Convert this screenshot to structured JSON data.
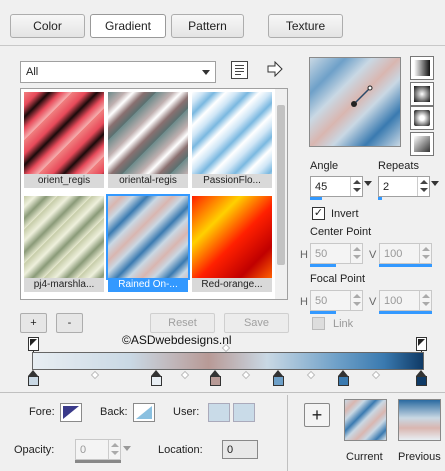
{
  "tabs": {
    "color": "Color",
    "gradient": "Gradient",
    "pattern": "Pattern",
    "texture": "Texture"
  },
  "filter": {
    "selected": "All"
  },
  "gradients": [
    {
      "label": "orient_regis"
    },
    {
      "label": "oriental-regis"
    },
    {
      "label": "PassionFlo..."
    },
    {
      "label": "pj4-marshla..."
    },
    {
      "label": "Rained On-..."
    },
    {
      "label": "Red-orange..."
    }
  ],
  "buttons": {
    "add": "+",
    "remove": "-",
    "reset": "Reset",
    "save": "Save",
    "new_swatch": "+"
  },
  "watermark": "©ASDwebdesigns.nl",
  "angle": {
    "label": "Angle",
    "value": "45"
  },
  "repeats": {
    "label": "Repeats",
    "value": "2"
  },
  "invert": {
    "label": "Invert",
    "checked": true
  },
  "center_point": {
    "label": "Center Point",
    "h_label": "H",
    "h_value": "50",
    "v_label": "V",
    "v_value": "100"
  },
  "focal_point": {
    "label": "Focal Point",
    "h_label": "H",
    "h_value": "50",
    "v_label": "V",
    "v_value": "100"
  },
  "link": {
    "label": "Link",
    "checked": false
  },
  "bottom": {
    "fore_label": "Fore:",
    "back_label": "Back:",
    "user_label": "User:",
    "opacity_label": "Opacity:",
    "opacity_value": "0",
    "location_label": "Location:",
    "location_value": "0",
    "current_label": "Current",
    "previous_label": "Previous"
  },
  "colors": {
    "accent": "#3399ff",
    "stop_colors": [
      "#c9d8e4",
      "#e8eef3",
      "#b89a96",
      "#6ea0c8",
      "#3a7ab0",
      "#0f3a66"
    ]
  }
}
